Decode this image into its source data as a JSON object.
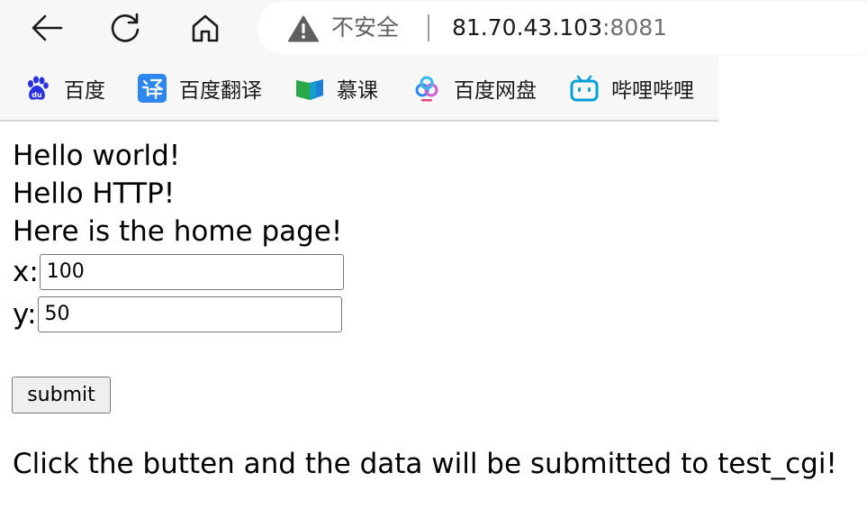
{
  "browser": {
    "security_label": "不安全",
    "url_host": "81.70.43.103",
    "url_port": ":8081",
    "icons": {
      "back": "back-arrow-icon",
      "refresh": "refresh-icon",
      "home": "home-icon",
      "security": "warning-triangle-icon"
    }
  },
  "favorites": [
    {
      "label": "百度",
      "icon": "baidu-paw-icon"
    },
    {
      "label": "百度翻译",
      "icon": "baidu-translate-icon"
    },
    {
      "label": "慕课",
      "icon": "mooc-book-icon"
    },
    {
      "label": "百度网盘",
      "icon": "baidu-netdisk-icon"
    },
    {
      "label": "哔哩哔哩",
      "icon": "bilibili-tv-icon"
    }
  ],
  "page": {
    "lines": [
      "Hello world!",
      "Hello HTTP!",
      "Here is the home page!"
    ],
    "x_label": "x:",
    "x_value": "100",
    "y_label": "y:",
    "y_value": "50",
    "submit_label": "submit",
    "note": "Click the butten and the data will be submitted to test_cgi!"
  },
  "colors": {
    "toolbar_bg": "#f7f7f7",
    "baidu_blue": "#2932e1",
    "translate_blue": "#2e86f0",
    "bilibili_blue": "#00a1d6"
  }
}
